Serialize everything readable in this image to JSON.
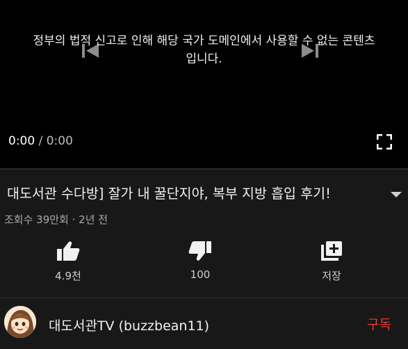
{
  "player": {
    "restriction_message_line1": "정부의 법적 신고로 인해 해당 국가 도메인에서 사용할 수 없는 콘텐츠",
    "restriction_message_line2": "입니다.",
    "current_time": "0:00",
    "separator": "/",
    "duration": "0:00",
    "icons": {
      "prev": "skip-previous-icon",
      "next": "skip-next-icon",
      "fullscreen": "fullscreen-icon"
    }
  },
  "video": {
    "title": "대도서관 수다방] 잘가 내 꿀단지야, 복부 지방 흡입 후기!",
    "meta": "조회수 39만회 · 2년 전",
    "expand_icon": "chevron-down-icon"
  },
  "actions": {
    "like_label": "4.9천",
    "dislike_label": "100",
    "save_label": "저장"
  },
  "channel": {
    "name": "대도서관TV (buzzbean11)",
    "subscribe_label": "구독"
  },
  "colors": {
    "background": "#181818",
    "player_bg": "#000000",
    "subscribe": "#e53935"
  }
}
